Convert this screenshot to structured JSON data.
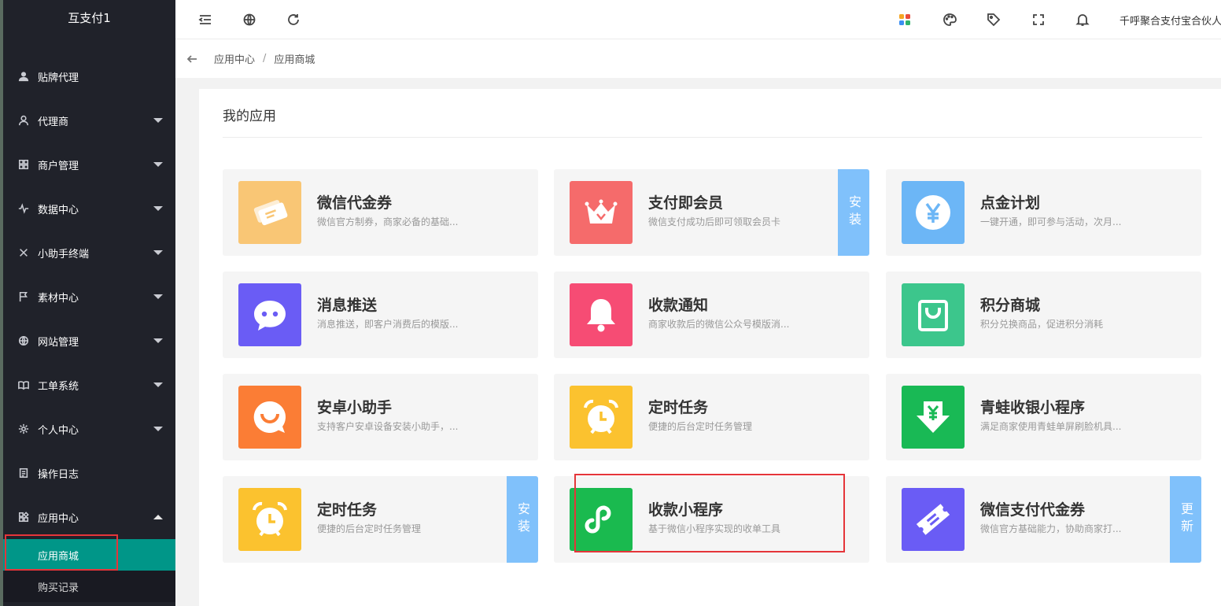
{
  "brand": "互支付1",
  "sidebar": {
    "items": [
      {
        "label": "贴牌代理"
      },
      {
        "label": "代理商"
      },
      {
        "label": "商户管理"
      },
      {
        "label": "数据中心"
      },
      {
        "label": "小助手终端"
      },
      {
        "label": "素材中心"
      },
      {
        "label": "网站管理"
      },
      {
        "label": "工单系统"
      },
      {
        "label": "个人中心"
      },
      {
        "label": "操作日志"
      },
      {
        "label": "应用中心"
      }
    ],
    "sub_items": [
      {
        "label": "应用商城",
        "active": true
      },
      {
        "label": "购买记录",
        "active": false
      }
    ]
  },
  "header": {
    "user": "千呼聚合支付宝合伙人"
  },
  "breadcrumb": [
    "应用中心",
    "/",
    "应用商城"
  ],
  "panel": {
    "title": "我的应用"
  },
  "apps": [
    {
      "title": "微信代金券",
      "desc": "微信官方制券，商家必备的基础...",
      "color": "#f9c675",
      "icon": "coupon-icon",
      "tag": ""
    },
    {
      "title": "支付即会员",
      "desc": "微信支付成功后即可领取会员卡",
      "color": "#f56b6b",
      "icon": "crown-icon",
      "tag": "安装"
    },
    {
      "title": "点金计划",
      "desc": "一键开通，即可参与活动，次月...",
      "color": "#6cb6f6",
      "icon": "yen-icon",
      "tag": ""
    },
    {
      "title": "消息推送",
      "desc": "消息推送，即客户消费后的模版...",
      "color": "#6a5cf5",
      "icon": "chat-icon",
      "tag": ""
    },
    {
      "title": "收款通知",
      "desc": "商家收款后的微信公众号模版消...",
      "color": "#f64c74",
      "icon": "bell-icon",
      "tag": ""
    },
    {
      "title": "积分商城",
      "desc": "积分兑换商品，促进积分消耗",
      "color": "#3cc68c",
      "icon": "shopping-bag-icon",
      "tag": ""
    },
    {
      "title": "安卓小助手",
      "desc": "支持客户安卓设备安装小助手，...",
      "color": "#fb7d35",
      "icon": "smile-chat-icon",
      "tag": ""
    },
    {
      "title": "定时任务",
      "desc": "便捷的后台定时任务管理",
      "color": "#fbc22f",
      "icon": "alarm-clock-icon",
      "tag": ""
    },
    {
      "title": "青蛙收银小程序",
      "desc": "满足商家使用青蛙单屏刷脸机具...",
      "color": "#19b955",
      "icon": "yen-download-icon",
      "tag": ""
    },
    {
      "title": "定时任务",
      "desc": "便捷的后台定时任务管理",
      "color": "#fbc22f",
      "icon": "alarm-clock-icon",
      "tag": "安装"
    },
    {
      "title": "收款小程序",
      "desc": "基于微信小程序实现的收单工具",
      "color": "#1aba4f",
      "icon": "mini-program-icon",
      "tag": ""
    },
    {
      "title": "微信支付代金券",
      "desc": "微信官方基础能力，协助商家打...",
      "color": "#6a5cf5",
      "icon": "ticket-icon",
      "tag": "更新"
    }
  ]
}
